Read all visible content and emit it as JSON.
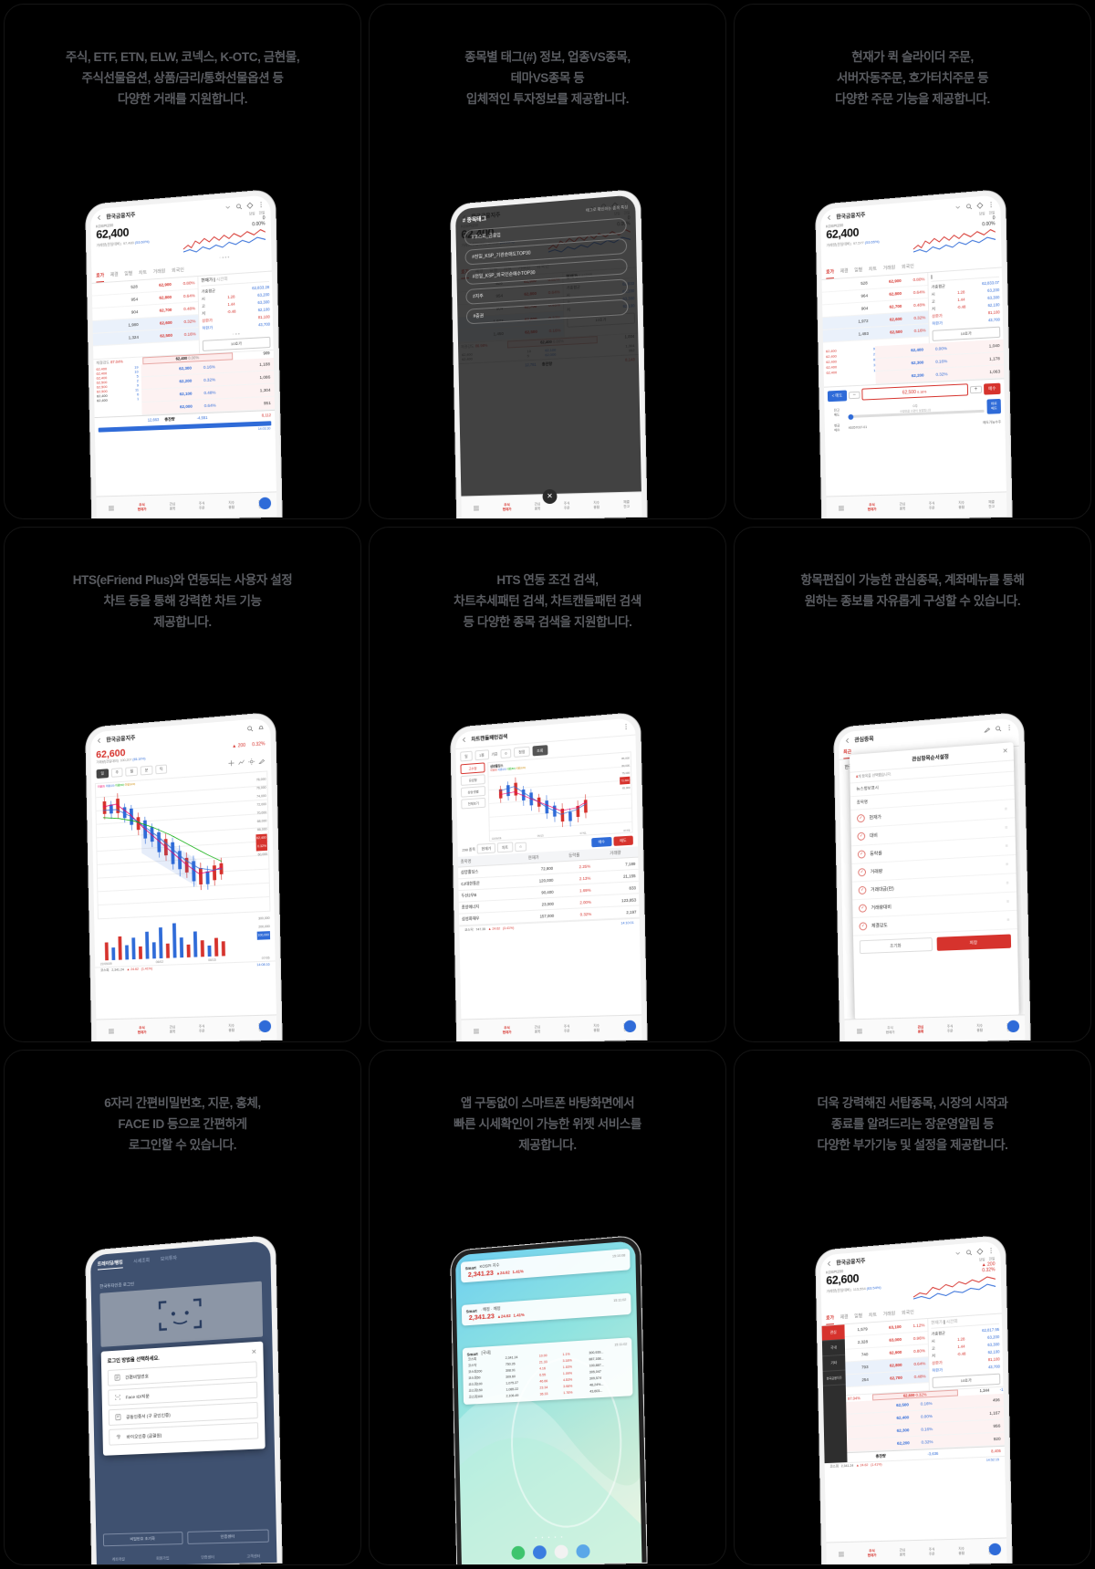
{
  "cards": [
    {
      "id": "card-trading-products",
      "caption": [
        "주식, ETF, ETN, ELW, 코넥스, K-OTC, 금현물,",
        "주식선물옵션, 상품/금리/통화선물옵션 등",
        "다양한 거래를 지원합니다."
      ],
      "screen": {
        "title": "한국금융지주",
        "index_label": "KOSPI200",
        "price": "62,400",
        "change": "0",
        "change_pct": "0.00%",
        "volume_label": "거래량(전일대비)",
        "volume": "97,483",
        "volume_pct": "(53.60%)",
        "period_tabs": [
          "당일",
          "전일"
        ],
        "tabs": [
          "호가",
          "제결",
          "일별",
          "차트",
          "거래원",
          "외국인"
        ],
        "active_tab": "호가",
        "right_header": "현재가",
        "right_header_sub": "시간외",
        "right_rows": [
          {
            "k": "가중평균",
            "v": "62,833.28"
          },
          {
            "k": "시",
            "d": "1.28",
            "v": "63,200"
          },
          {
            "k": "고",
            "d": "1.44",
            "v": "63,300"
          },
          {
            "k": "저",
            "d": "-0.48",
            "v": "62,100"
          },
          {
            "k": "상한가",
            "d": "",
            "v": "81,100"
          },
          {
            "k": "하한가",
            "d": "",
            "v": "43,700"
          }
        ],
        "hoga_button": "10호가",
        "asks": [
          {
            "qty": "528",
            "price": "62,900",
            "pct": "0.80%"
          },
          {
            "qty": "954",
            "price": "62,800",
            "pct": "0.64%"
          },
          {
            "qty": "904",
            "price": "62,700",
            "pct": "0.48%"
          },
          {
            "qty": "1,980",
            "price": "62,600",
            "pct": "0.32%"
          },
          {
            "qty": "1,324",
            "price": "62,500",
            "pct": "0.16%"
          }
        ],
        "current_row": {
          "strength_label": "체결강도",
          "strength": "87.04%",
          "price": "62,400",
          "pct": "0.00%",
          "qty": "909"
        },
        "bids": [
          {
            "small": [
              "62,400",
              "62,400"
            ],
            "n": [
              "19",
              "10"
            ],
            "price": "62,300",
            "pct": "0.16%",
            "qty": "1,188"
          },
          {
            "small": [
              "62,400",
              "62,500"
            ],
            "n": [
              "5",
              "2"
            ],
            "price": "62,200",
            "pct": "0.32%",
            "qty": "1,086"
          },
          {
            "small": [
              "62,500",
              "62,500"
            ],
            "n": [
              "9",
              "11"
            ],
            "price": "62,100",
            "pct": "0.48%",
            "qty": "1,304"
          },
          {
            "small": [
              "62,400",
              "62,400"
            ],
            "n": [
              "6",
              "1"
            ],
            "price": "62,000",
            "pct": "0.64%",
            "qty": "951"
          }
        ],
        "total_row": {
          "left": "12,663",
          "label": "총잔량",
          "mid": "-4,551",
          "right": "8,112"
        },
        "time": "14:03:30",
        "nav": [
          "주식\n현재가",
          "관심\n종목",
          "주식\n주문",
          "지수\n종합",
          "체결\n잔고"
        ]
      }
    },
    {
      "id": "card-stock-tags",
      "caption": [
        "종목별 태그(#) 정보, 업종VS종목,",
        "테마VS종목 등",
        "입체적인 투자정보를 제공합니다."
      ],
      "screen": {
        "title": "한국금융지주",
        "index_label": "KOSPI200",
        "price": "62,400",
        "change": "0",
        "change_pct": "0.00%",
        "volume_label": "거래량(전일대비)",
        "volume": "97,532",
        "volume_pct": "(53.63%)",
        "overlay_title": "# 종목태그",
        "overlay_sub": "태그로 확인하는 종목 특징",
        "tags": [
          "#코스피_금융업",
          "#전일_KSP_기관순매도TOP30",
          "#전일_KSP_외국인순매수TOP30",
          "#지주",
          "#증권"
        ],
        "close_icon": "✕"
      }
    },
    {
      "id": "card-order-features",
      "caption": [
        "현재가 퀵 슬라이더 주문,",
        "서버자동주문, 호가터치주문 등",
        "다양한 주문 기능을 제공합니다."
      ],
      "screen": {
        "title": "한국금융지주",
        "index_label": "KOSPI200",
        "price": "62,400",
        "change": "0",
        "change_pct": "0.00%",
        "volume_label": "거래량(전일대비)",
        "volume": "97,577",
        "volume_pct": "(53.65%)",
        "sell_button": "매도",
        "buy_button": "매수",
        "order_price": "62,500",
        "order_pct": "0.16%",
        "qty_label": "잔고\n매도",
        "instant_sell": "바로\n매도",
        "cash_label": "현금\n매수",
        "slider_label": "0주",
        "slider_sub": "수량만큼 수량이 설정됩니다",
        "account": "46357037-01",
        "account_right": "매도가능수주",
        "asks": [
          {
            "qty": "528",
            "price": "62,900",
            "pct": "0.80%"
          },
          {
            "qty": "964",
            "price": "62,800",
            "pct": "0.64%"
          },
          {
            "qty": "904",
            "price": "62,700",
            "pct": "0.48%"
          },
          {
            "qty": "1,972",
            "price": "62,600",
            "pct": "0.32%"
          },
          {
            "qty": "1,493",
            "price": "62,500",
            "pct": "0.16%"
          }
        ],
        "bids": [
          {
            "price": "62,400",
            "pct": "0.00%",
            "qty": "1,040"
          },
          {
            "price": "62,300",
            "pct": "0.16%",
            "qty": "1,178"
          },
          {
            "price": "62,200",
            "pct": "0.32%",
            "qty": "1,063"
          }
        ],
        "right_rows": [
          {
            "k": "가중평균",
            "v": "62,833.07"
          },
          {
            "k": "시",
            "d": "1.28",
            "v": "63,200"
          },
          {
            "k": "고",
            "d": "1.44",
            "v": "63,300"
          },
          {
            "k": "저",
            "d": "-0.48",
            "v": "62,100"
          },
          {
            "k": "상한가",
            "d": "",
            "v": "81,100"
          },
          {
            "k": "하한가",
            "d": "",
            "v": "43,700"
          }
        ],
        "hoga_button": "10호가"
      }
    },
    {
      "id": "card-chart",
      "caption": [
        "HTS(eFriend Plus)와 연동되는 사용자 설정",
        "차트 등을 통해 강력한 차트 기능",
        "제공합니다."
      ],
      "screen": {
        "title": "한국금융지주",
        "price": "62,600",
        "change": "200",
        "change_pct": "0.32%",
        "volume_label": "거래량(전일대비)",
        "volume": "100,207",
        "volume_pct": "(55.10%)",
        "period_tabs": [
          "일",
          "주",
          "월",
          "분",
          "틱"
        ],
        "active_period": "일",
        "legend": [
          "이동평균(5)",
          "이동평균(10)",
          "이동평균(20)",
          "이동평균(60)",
          "이동평균(120)"
        ],
        "price_axis": [
          "78,000",
          "76,000",
          "74,000",
          "72,000",
          "70,000",
          "68,000",
          "66,000",
          "64,000",
          "62,000",
          "60,000"
        ],
        "vol_axis": [
          "300,000",
          "200,000",
          "100,000"
        ],
        "marker_price": "62,400",
        "marker_pct": "0.32%",
        "annotations": [
          "21,700(1-4.54%, 2022/05/31)",
          "59,100(-5.59%, 2022/06/22)"
        ],
        "x_labels": [
          "22/05/09",
          "06/02",
          "06/15",
          "07/05"
        ],
        "bottom_index": [
          "코스피",
          "2,341.24",
          "▲ 24.62",
          "(1.41%)",
          "14:08:16"
        ],
        "nav": [
          "주식\n현재가",
          "관심\n종목",
          "주식\n주문",
          "지수\n종합",
          "체결\n잔고"
        ]
      }
    },
    {
      "id": "card-condition-search",
      "caption": [
        "HTS 연동 조건 검색,",
        "차트추세패턴 검색, 차트캔들패턴 검색",
        "등 다양한 종목 검색을 지원합니다."
      ],
      "screen": {
        "title": "차트캔들패턴검색",
        "filters": [
          "일",
          "1봉",
          "기준",
          "0",
          "정정"
        ],
        "search_button": "조회",
        "pattern_labels": [
          "고수정",
          "유성형",
          "상승샛별",
          "전체보기"
        ],
        "chart_title": "삼양홀딩스",
        "legend": [
          "이동평균(5)",
          "이동평균(20)",
          "이동평균(60)",
          "이동평균(120)"
        ],
        "axis": [
          "85,000",
          "80,000",
          "75,000",
          "70,000",
          "65,000"
        ],
        "marker": "72,800",
        "annotations": [
          "81,100(11.40%, 2022/06/09)",
          "69,900(-3.58%, 2022/07/04)"
        ],
        "x_labels": [
          "22/06/06",
          "06/15",
          "07/01",
          "07/05"
        ],
        "count_label": "298 종목",
        "col_buttons": [
          "현재가",
          "차트",
          "☆"
        ],
        "buy_button": "매수",
        "sell_button": "매도",
        "table_headers": [
          "종목명",
          "현재가",
          "등락률",
          "거래량"
        ],
        "rows": [
          [
            "삼양홀딩스",
            "72,800",
            "2.25%",
            "7,189"
          ],
          [
            "CJ대한통운",
            "120,000",
            "2.13%",
            "21,155"
          ],
          [
            "두산2우B",
            "90,400",
            "1.69%",
            "833"
          ],
          [
            "종양에너지",
            "23,000",
            "2.00%",
            "123,853"
          ],
          [
            "삼성화재우",
            "157,000",
            "0.32%",
            "2,197"
          ]
        ],
        "bottom_index": [
          "코스닥",
          "747.35",
          "▲ 24.62",
          "(3.41%)",
          "14:10:01"
        ],
        "nav": [
          "주식\n현재가",
          "관심\n종목",
          "주식\n주문",
          "지수\n종합",
          "체결\n잔고"
        ]
      }
    },
    {
      "id": "card-watchlist-config",
      "caption": [
        "항목편집이 가능한 관심종목, 계좌메뉴를 통해",
        "원하는 종보를 자유롭게 구성할 수 있습니다."
      ],
      "screen": {
        "title": "관심종목",
        "tab": "최근",
        "row_name": "한국금융지주",
        "modal_title": "관심항목순서설정",
        "modal_note_count": "8",
        "modal_note": "개 항목을 선택했습니다.",
        "section1": "뉴스정보표시",
        "section2": "종목명",
        "items": [
          "현재가",
          "대비",
          "등락률",
          "거래량",
          "거래대금(만)",
          "거래량대비",
          "체결강도"
        ],
        "reset_button": "초기화",
        "save_button": "저장",
        "nav": [
          "주식\n현재가",
          "관심\n종목",
          "주식\n주문",
          "지수\n종합",
          "체결\n잔고"
        ]
      }
    },
    {
      "id": "card-simple-login",
      "caption": [
        "6자리 간편비밀번호, 지문, 홍체,",
        "FACE ID 등으로 간편하게",
        "로그인할 수 있습니다."
      ],
      "screen": {
        "tabs": [
          "트레이딩/뱅킹",
          "시세조회",
          "모의투자"
        ],
        "active_tab": "트레이딩/뱅킹",
        "cert_label": "한국투자인증 로그인",
        "modal_title": "로그인 방법을 선택하세요.",
        "close_icon": "✕",
        "options": [
          "간편비밀번호",
          "Face ID/지문",
          "공동인증서 (구 공인인증)",
          "바이오인증 (금결원)"
        ],
        "bottom_buttons": [
          "비밀번호 초기화",
          "인증센터"
        ],
        "footer": [
          "계좌개설",
          "회원가입",
          "인증센터",
          "고객센터"
        ]
      }
    },
    {
      "id": "card-widget",
      "caption": [
        "앱 구동없이 스마트폰 바탕화면에서",
        "빠른 시세확인이 가능한 위젯 서비스를",
        "제공합니다."
      ],
      "screen": {
        "widgets": [
          {
            "brand": "Smart",
            "name": "KOSPI 지수",
            "time": "15:10:08",
            "value": "2,341.23",
            "delta": "▲24.62",
            "pct": "1.41%"
          },
          {
            "brand": "Smart",
            "name": "· 예정 · 예정",
            "time": "15:11:02",
            "value": "2,341.23",
            "delta": "▲24.62",
            "pct": "1.41%"
          },
          {
            "brand": "Smart",
            "name": "[국내]",
            "time": "15:11:02",
            "rows": [
              [
                "코스피",
                "2,341.24",
                "10.00",
                "1.1%",
                "300,939..."
              ],
              [
                "코스닥",
                "750.26",
                "21.33",
                "3.18%",
                "887,168..."
              ],
              [
                "코스피200",
                "308.91",
                "4.16",
                "1.63%",
                "100,887..."
              ],
              [
                "코스피50",
                "309.60",
                "6.55",
                "1.09%",
                "305,047"
              ],
              [
                "코스피100",
                "1,075.27",
                "46.66",
                "4.53%",
                "309,574"
              ],
              [
                "코스피150",
                "1,085.22",
                "23.34",
                "3.66%",
                "48,24%..."
              ],
              [
                "코스피300",
                "2,106.49",
                "36.33",
                "1.76%",
                "43,603..."
              ]
            ]
          }
        ],
        "dots": "• • • • •",
        "dock_icons": [
          "phone-icon",
          "message-icon",
          "play-icon",
          "browser-icon"
        ]
      }
    },
    {
      "id": "card-extra-features",
      "caption": [
        "더욱 강력해진 서탑종목, 시장의 시작과",
        "종료를 알려드리는 장운영알림 등",
        "다양한 부가기능 및 설정을 제공합니다."
      ],
      "screen": {
        "title": "한국금융지주",
        "index_label": "KOSPI200",
        "price": "62,600",
        "change": "200",
        "change_pct": "0.32%",
        "volume_label": "거래량(전일대비)",
        "volume": "115,554",
        "volume_pct": "(63.54%)",
        "period_tabs": [
          "당일",
          "전일"
        ],
        "tabs": [
          "호가",
          "제결",
          "일별",
          "차트",
          "거래원",
          "외국인"
        ],
        "active_tab": "호가",
        "side_items": [
          "관심",
          "국내",
          "기타",
          "한국금융지주"
        ],
        "right_header": "현재가",
        "right_header_sub": "시간외",
        "right_rows": [
          {
            "k": "가중평균",
            "v": "62,817.95"
          },
          {
            "k": "시",
            "d": "1.28",
            "v": "63,200"
          },
          {
            "k": "고",
            "d": "1.44",
            "v": "63,300"
          },
          {
            "k": "저",
            "d": "-0.48",
            "v": "62,100"
          },
          {
            "k": "상한가",
            "d": "",
            "v": "81,100"
          },
          {
            "k": "하한가",
            "d": "",
            "v": "43,700"
          }
        ],
        "hoga_button": "10호가",
        "asks": [
          {
            "qty": "1,579",
            "price": "63,100",
            "pct": "1.12%"
          },
          {
            "qty": "2,328",
            "price": "63,000",
            "pct": "0.96%"
          },
          {
            "qty": "740",
            "price": "62,900",
            "pct": "0.80%"
          },
          {
            "qty": "793",
            "price": "62,800",
            "pct": "0.64%"
          },
          {
            "qty": "254",
            "price": "62,700",
            "pct": "0.48%"
          }
        ],
        "current_row": {
          "strength": "97.04%",
          "price": "62,600",
          "pct": "0.32%",
          "qty": "1,344",
          "extra": "-1"
        },
        "bids": [
          {
            "price": "62,500",
            "pct": "0.16%",
            "qty": "496"
          },
          {
            "price": "62,400",
            "pct": "0.00%",
            "qty": "1,167"
          },
          {
            "price": "62,300",
            "pct": "0.16%",
            "qty": "956"
          },
          {
            "price": "62,200",
            "pct": "0.32%",
            "qty": "920"
          }
        ],
        "total_row": {
          "label": "총잔량",
          "mid": "-3,636",
          "right": "8,406"
        },
        "bottom_index": [
          "코스피",
          "2,341.24",
          "▲ 24.62",
          "(1.41%)",
          "14:52:15"
        ],
        "nav": [
          "주식\n현재가",
          "관심\n종목",
          "주식\n주문",
          "지수\n종합",
          "체결\n잔고"
        ]
      }
    }
  ],
  "colors": {
    "bg": "#000000",
    "caption": "#5a5c61",
    "up": "#d6332d",
    "down": "#2f6bd8",
    "accent": "#d6332d"
  }
}
